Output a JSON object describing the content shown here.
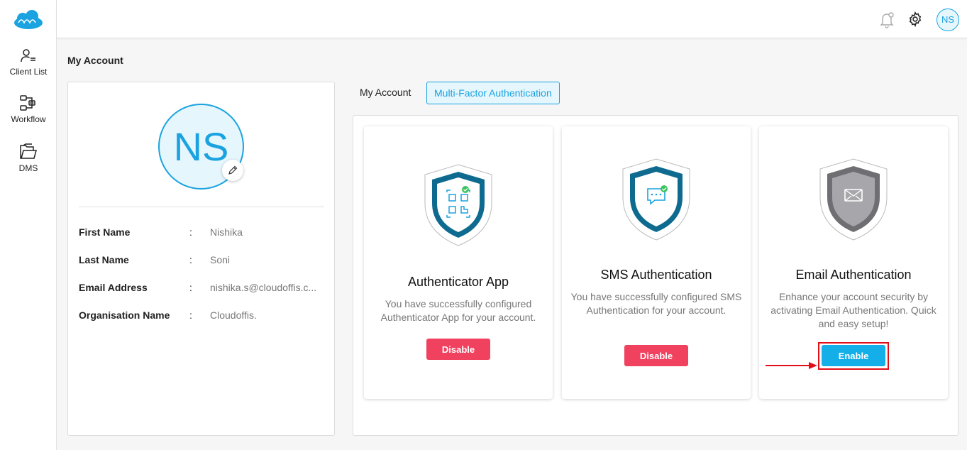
{
  "sidebar": {
    "logo_icon": "cloud-logo-icon",
    "items": [
      {
        "label": "Client List",
        "icon": "client-list-icon"
      },
      {
        "label": "Workflow",
        "icon": "workflow-icon"
      },
      {
        "label": "DMS",
        "icon": "folder-icon"
      }
    ]
  },
  "header": {
    "icons": [
      "bell-icon",
      "gear-icon"
    ],
    "user_initials": "NS"
  },
  "page": {
    "title": "My Account"
  },
  "profile": {
    "initials": "NS",
    "fields": [
      {
        "label": "First Name",
        "colon": ":",
        "value": "Nishika"
      },
      {
        "label": "Last Name",
        "colon": ":",
        "value": "Soni"
      },
      {
        "label": "Email Address",
        "colon": ":",
        "value": "nishika.s@cloudoffis.c..."
      },
      {
        "label": "Organisation Name",
        "colon": ":",
        "value": "Cloudoffis."
      }
    ]
  },
  "tabs": [
    {
      "label": "My Account",
      "active": false
    },
    {
      "label": "Multi-Factor Authentication",
      "active": true
    }
  ],
  "mfa_cards": [
    {
      "title": "Authenticator App",
      "description": "You have successfully configured Authenticator App for your account.",
      "button": "Disable",
      "icon": "qr-shield-icon",
      "status": "configured"
    },
    {
      "title": "SMS Authentication",
      "description": "You have successfully configured SMS Authentication for your account.",
      "button": "Disable",
      "icon": "sms-shield-icon",
      "status": "configured"
    },
    {
      "title": "Email Authentication",
      "description": "Enhance your account security by activating Email Authentication. Quick and easy setup!",
      "button": "Enable",
      "icon": "email-shield-icon",
      "status": "not-configured"
    }
  ],
  "colors": {
    "accent": "#1aa3e0",
    "disable": "#f0415f",
    "enable": "#14aee8",
    "annotation": "#e0101a",
    "shield_active": "#0e6b8f",
    "shield_inactive": "#6e6e73"
  }
}
